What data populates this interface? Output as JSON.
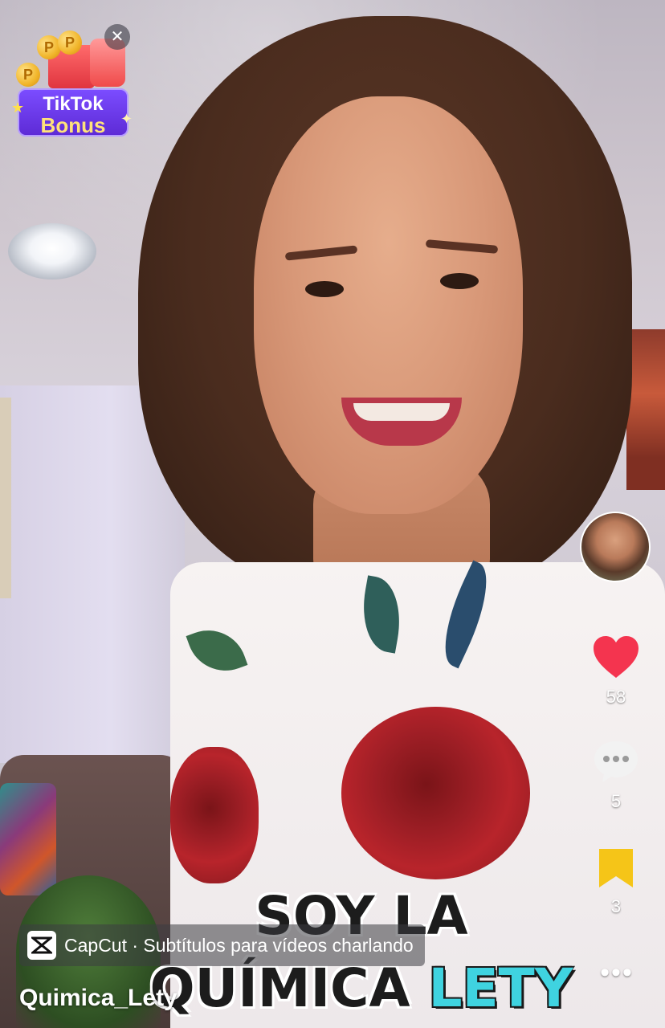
{
  "promo": {
    "line1": "TikTok",
    "line2": "Bonus",
    "coin_symbol": "P",
    "close_symbol": "✕"
  },
  "actions": {
    "likes": "58",
    "comments": "5",
    "saves": "3",
    "more_symbol": "•••"
  },
  "colors": {
    "heart": "#f4344f",
    "bookmark": "#f5c518",
    "caption_accent": "#3fd3e0"
  },
  "caption": {
    "line1": "SOY LA",
    "line2_word1": "QUÍMICA",
    "line2_word2": "LETY"
  },
  "capcut": {
    "text": "CapCut · Subtítulos para vídeos charlando"
  },
  "author": {
    "username": "Quimica_Lety"
  }
}
